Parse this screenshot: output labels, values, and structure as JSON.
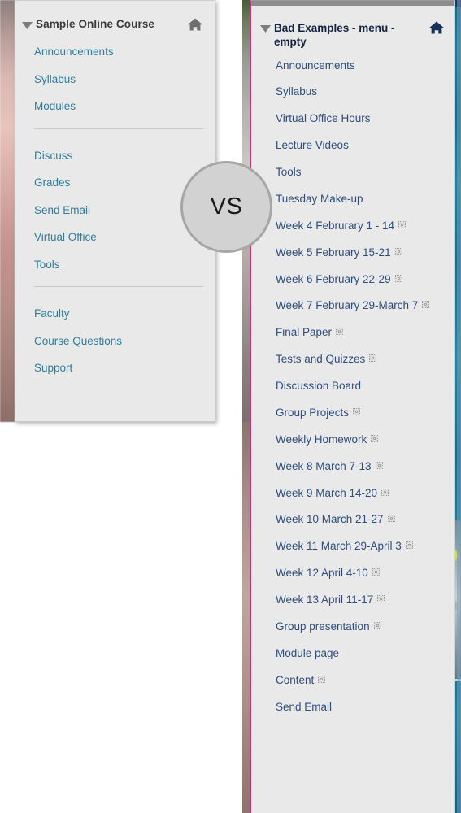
{
  "comparison": {
    "badge_label": "VS"
  },
  "left_panel": {
    "title": "Sample Online Course",
    "caret_icon": "caret-down-icon",
    "home_icon": "home-icon",
    "groups": [
      {
        "items": [
          {
            "label": "Announcements"
          },
          {
            "label": "Syllabus"
          },
          {
            "label": "Modules"
          }
        ]
      },
      {
        "items": [
          {
            "label": "Discuss"
          },
          {
            "label": "Grades"
          },
          {
            "label": "Send Email"
          },
          {
            "label": "Virtual Office"
          },
          {
            "label": "Tools"
          }
        ]
      },
      {
        "items": [
          {
            "label": "Faculty"
          },
          {
            "label": "Course Questions"
          },
          {
            "label": "Support"
          }
        ]
      }
    ],
    "link_color": "#2d7e99",
    "title_color": "#3a3a3a",
    "background_color": "#e9e9e9"
  },
  "right_panel": {
    "title": "Bad Examples - menu - empty",
    "caret_icon": "caret-down-icon",
    "home_icon": "home-icon",
    "items": [
      {
        "label": "Announcements",
        "placeholder_icon": false
      },
      {
        "label": "Syllabus",
        "placeholder_icon": false
      },
      {
        "label": "Virtual Office Hours",
        "placeholder_icon": false
      },
      {
        "label": "Lecture Videos",
        "placeholder_icon": false
      },
      {
        "label": "Tools",
        "placeholder_icon": false
      },
      {
        "label": "Tuesday Make-up",
        "placeholder_icon": false
      },
      {
        "label": "Week 4 Februrary 1 - 14",
        "placeholder_icon": true
      },
      {
        "label": "Week 5 February 15-21",
        "placeholder_icon": true
      },
      {
        "label": "Week 6 February 22-29",
        "placeholder_icon": true
      },
      {
        "label": "Week 7 February 29-March 7",
        "placeholder_icon": true
      },
      {
        "label": "Final Paper",
        "placeholder_icon": true
      },
      {
        "label": "Tests and Quizzes",
        "placeholder_icon": true
      },
      {
        "label": "Discussion Board",
        "placeholder_icon": false
      },
      {
        "label": "Group Projects",
        "placeholder_icon": true
      },
      {
        "label": "Weekly Homework",
        "placeholder_icon": true
      },
      {
        "label": "Week 8 March 7-13",
        "placeholder_icon": true
      },
      {
        "label": "Week 9 March 14-20",
        "placeholder_icon": true
      },
      {
        "label": "Week 10 March 21-27",
        "placeholder_icon": true
      },
      {
        "label": "Week 11 March 29-April 3",
        "placeholder_icon": true
      },
      {
        "label": "Week 12 April 4-10",
        "placeholder_icon": true
      },
      {
        "label": "Week 13 April 11-17",
        "placeholder_icon": true
      },
      {
        "label": "Group presentation",
        "placeholder_icon": true
      },
      {
        "label": "Module page",
        "placeholder_icon": false
      },
      {
        "label": "Content",
        "placeholder_icon": true
      },
      {
        "label": "Send Email",
        "placeholder_icon": false
      }
    ],
    "link_color": "#2f4d7d",
    "title_color": "#14233f",
    "background_color": "#e9e9e9",
    "accent_border_color": "#c9317f"
  }
}
